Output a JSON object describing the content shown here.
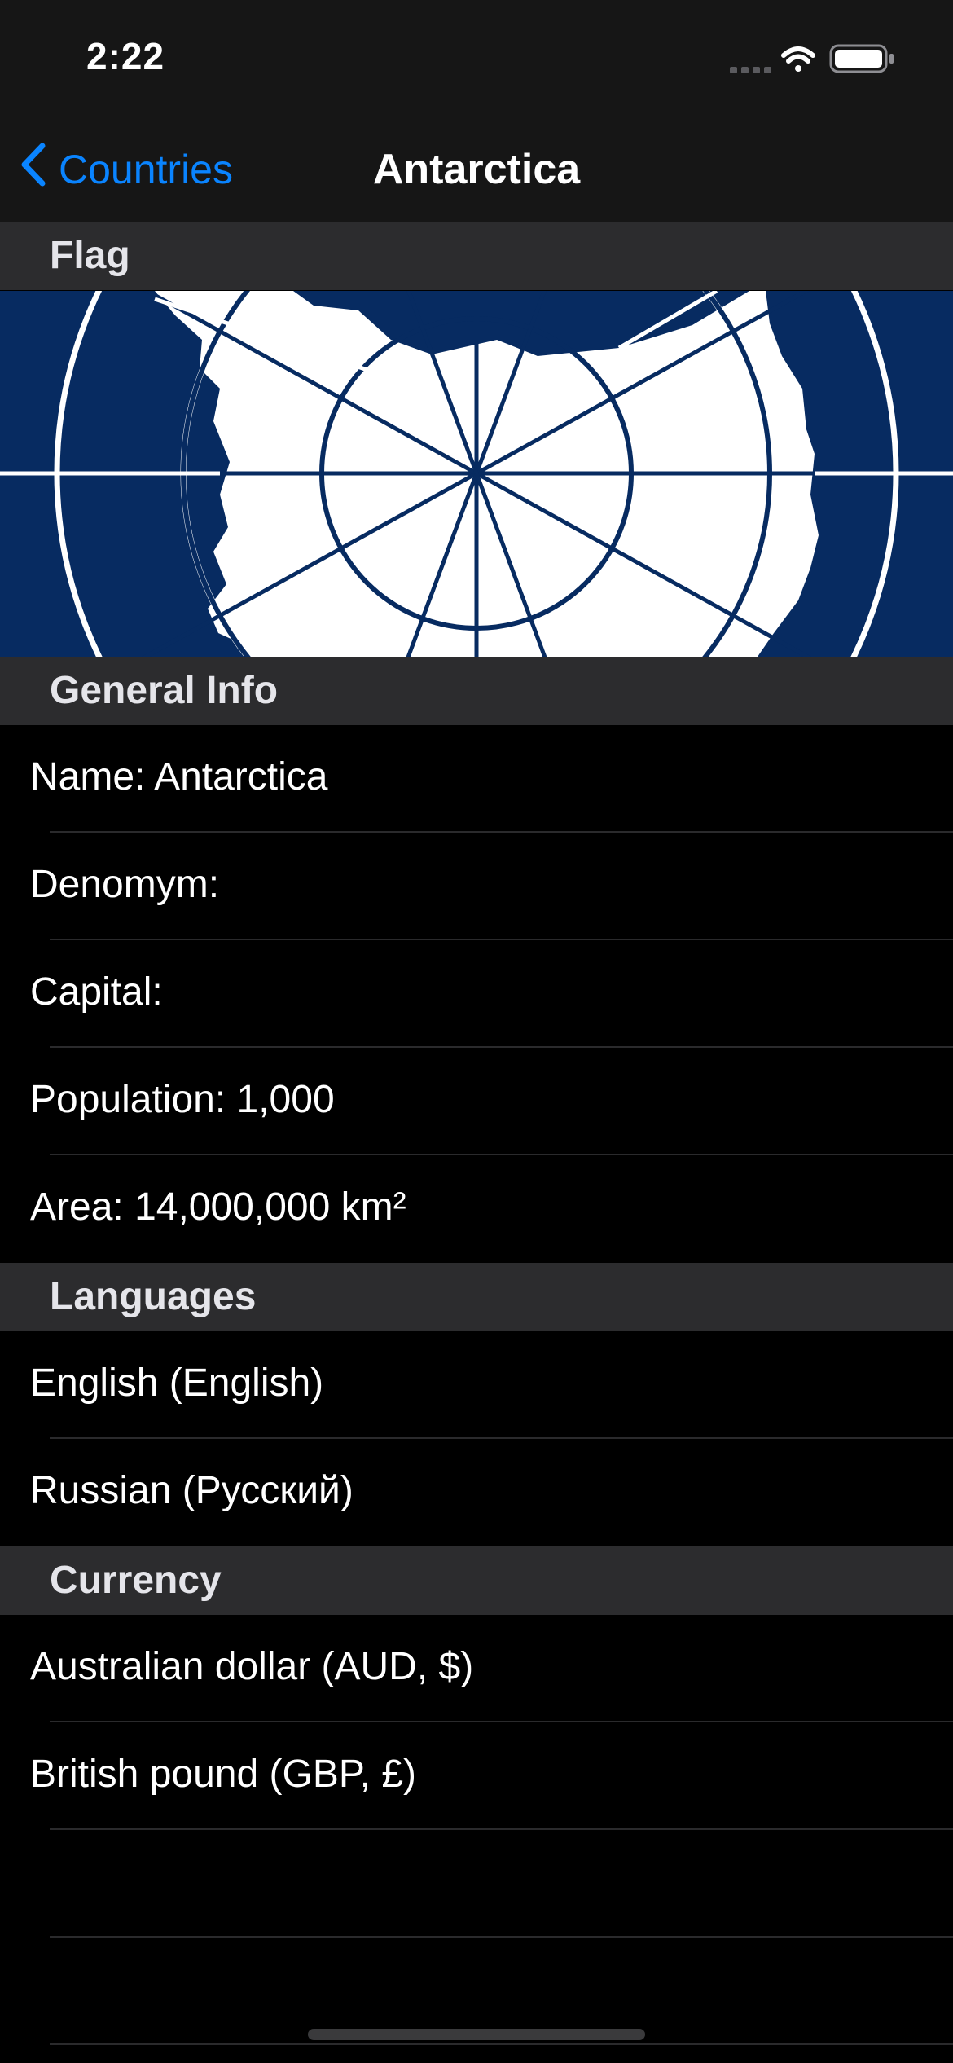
{
  "status_bar": {
    "time": "2:22"
  },
  "nav": {
    "back_label": "Countries",
    "title": "Antarctica"
  },
  "sections": {
    "flag": "Flag",
    "general": "General Info",
    "languages": "Languages",
    "currency": "Currency"
  },
  "general_info": [
    "Name: Antarctica",
    "Denomym:",
    "Capital:",
    "Population: 1,000",
    "Area: 14,000,000 km²"
  ],
  "languages": [
    "English (English)",
    "Russian (Русский)"
  ],
  "currencies": [
    "Australian dollar (AUD, $)",
    "British pound (GBP, £)"
  ],
  "colors": {
    "accent": "#0a84ff",
    "flag_blue": "#072b61",
    "section_bg": "#2c2c2e",
    "bar_bg": "#161616"
  },
  "icons": [
    "chevron-left-icon",
    "cellular-signal-icon",
    "wifi-icon",
    "battery-icon"
  ]
}
